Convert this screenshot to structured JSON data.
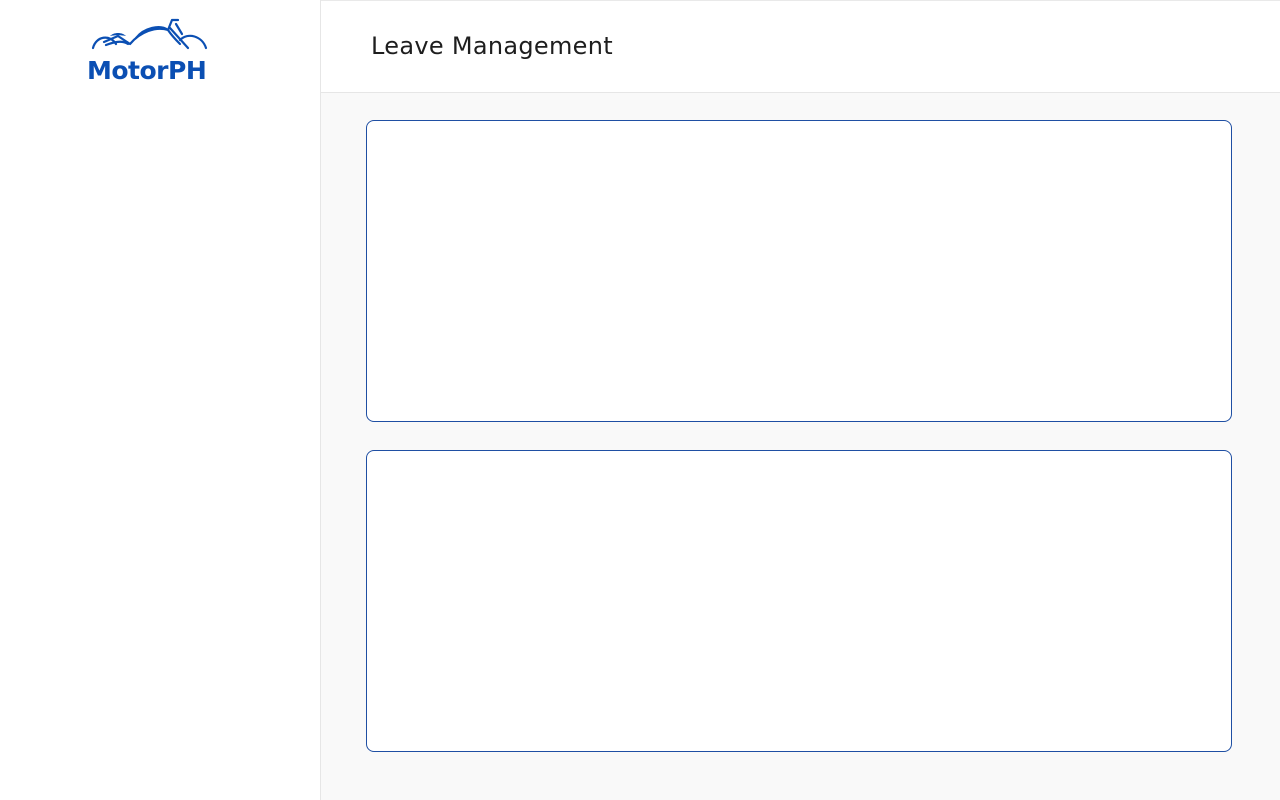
{
  "brand": {
    "name": "MotorPH",
    "color": "#0b4fb3"
  },
  "header": {
    "title": "Leave Management"
  },
  "colors": {
    "panel_border": "#1f4fa3",
    "main_background": "#f9f9f9",
    "title_text": "#1e1e1e"
  },
  "panels": [
    {
      "id": "panel-1"
    },
    {
      "id": "panel-2"
    }
  ]
}
